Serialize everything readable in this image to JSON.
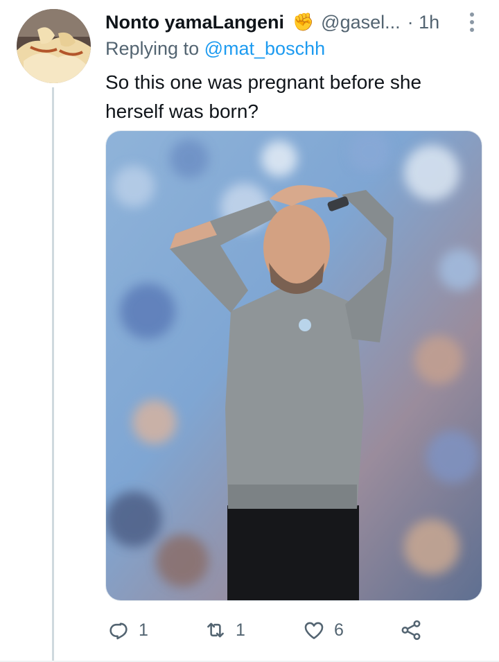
{
  "tweet": {
    "display_name": "Nonto yamaLangeni",
    "name_emoji": "✊",
    "handle": "@gasel...",
    "separator_time": "· 1h",
    "replying_prefix": "Replying to",
    "replying_to": "@mat_boschh",
    "text": "So this one was pregnant before she herself was born?"
  },
  "actions": {
    "reply_count": "1",
    "retweet_count": "1",
    "like_count": "6"
  },
  "icons": {
    "more": "more-vertical-icon",
    "reply": "reply-icon",
    "retweet": "retweet-icon",
    "like": "heart-icon",
    "share": "share-icon"
  },
  "colors": {
    "text_primary": "#0f1419",
    "text_secondary": "#536471",
    "accent": "#1d9bf0",
    "thread_line": "#cfd9de"
  }
}
